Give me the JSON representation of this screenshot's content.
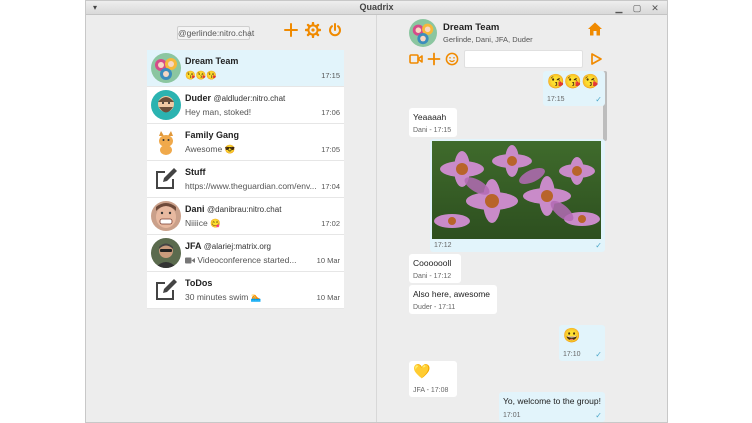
{
  "window": {
    "title": "Quadrix",
    "menu_glyph": "▾",
    "minimize_glyph": "▁",
    "maximize_glyph": "▢",
    "close_glyph": "✕"
  },
  "left": {
    "user_handle": "@gerlinde:nitro.chat",
    "chats": [
      {
        "name": "Dream Team",
        "handle": "",
        "preview": "😘😘😘",
        "time": "17:15",
        "active": true,
        "avatar": "group"
      },
      {
        "name": "Duder",
        "handle": "@aldluder:nitro.chat",
        "preview": "Hey man, stoked!",
        "time": "17:06",
        "active": false,
        "avatar": "duder"
      },
      {
        "name": "Family Gang",
        "handle": "",
        "preview": "Awesome 😎",
        "time": "17:05",
        "active": false,
        "avatar": "cat"
      },
      {
        "name": "Stuff",
        "handle": "",
        "preview": "https://www.theguardian.com/env...",
        "time": "17:04",
        "active": false,
        "avatar": "note"
      },
      {
        "name": "Dani",
        "handle": "@danibrau:nitro.chat",
        "preview": "Niiiice 😋",
        "time": "17:02",
        "active": false,
        "avatar": "dani"
      },
      {
        "name": "JFA",
        "handle": "@alariej:matrix.org",
        "preview": "Videoconference started...",
        "time": "10 Mar",
        "active": false,
        "avatar": "jfa"
      },
      {
        "name": "ToDos",
        "handle": "",
        "preview": "30 minutes swim 🏊",
        "time": "10 Mar",
        "active": false,
        "avatar": "note"
      }
    ]
  },
  "right": {
    "title": "Dream Team",
    "members": "Gerlinde, Dani, JFA, Duder",
    "input_value": "",
    "input_placeholder": "",
    "messages": [
      {
        "dir": "out",
        "text": "😘😘😘",
        "meta": "17:15",
        "check": "✓"
      },
      {
        "dir": "in",
        "text": "Yeaaaah",
        "meta": "Dani - 17:15"
      },
      {
        "dir": "out",
        "text": "",
        "meta": "17:12",
        "check": "✓",
        "image": true
      },
      {
        "dir": "in",
        "text": "Cooooooll",
        "meta": "Dani - 17:12"
      },
      {
        "dir": "in",
        "text": "Also here, awesome",
        "meta": "Duder - 17:11"
      },
      {
        "dir": "out",
        "text": "😀",
        "meta": "17:10",
        "check": "✓"
      },
      {
        "dir": "in",
        "text": "💛",
        "meta": "JFA - 17:08"
      },
      {
        "dir": "out",
        "text": "Yo, welcome to the group!",
        "meta": "17:01",
        "check": "✓"
      }
    ]
  },
  "colors": {
    "accent": "#f08a00",
    "active_bg": "#e2f4fb",
    "check": "#4ea7c9"
  },
  "icons": [
    "add-icon",
    "settings-gear-icon",
    "power-icon",
    "home-icon",
    "video-camera-icon",
    "plus-icon",
    "emoji-icon",
    "send-icon",
    "edit-note-icon"
  ]
}
